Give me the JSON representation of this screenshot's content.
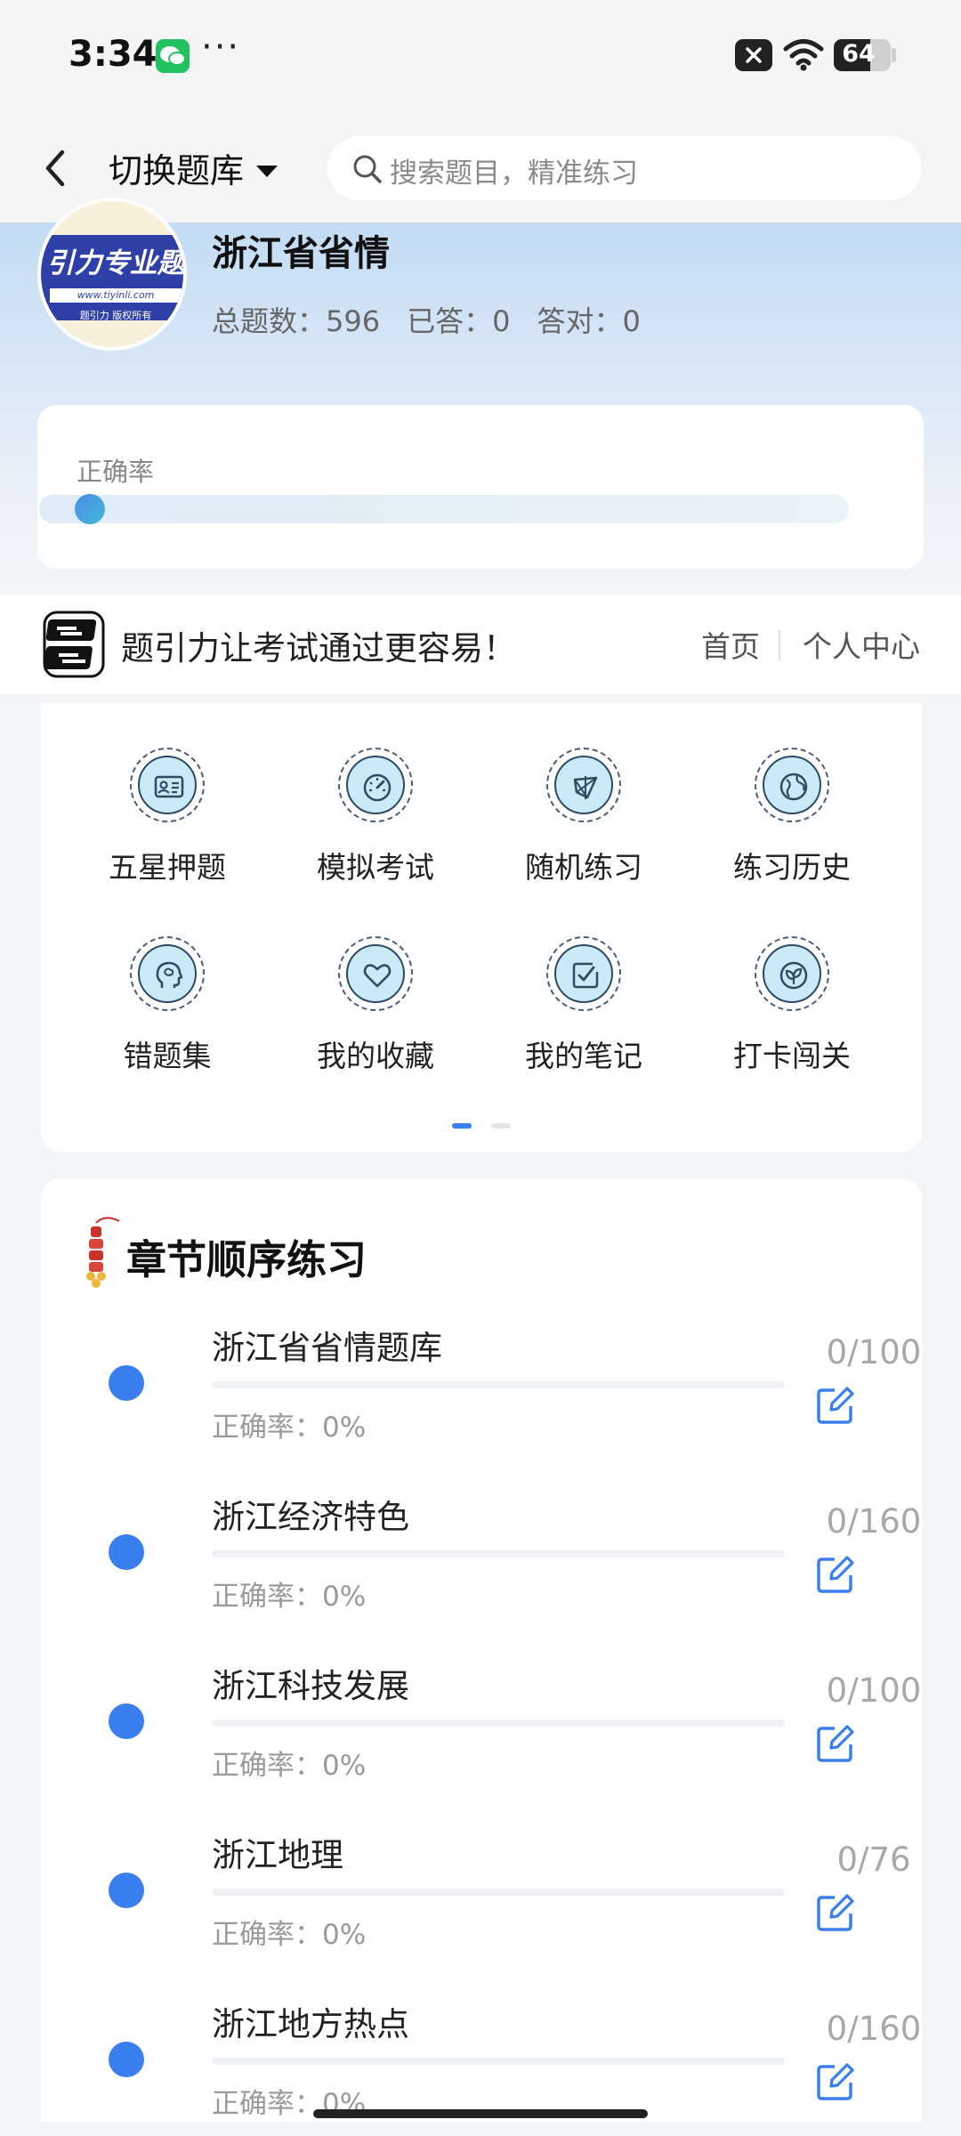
{
  "status_bar": {
    "time": "3:34",
    "more": "···",
    "battery": "64",
    "icons": [
      "wechat-icon",
      "close-notification-icon",
      "wifi-icon",
      "battery-icon"
    ]
  },
  "nav": {
    "back_icon": "chevron-left-icon",
    "switch_label": "切换题库",
    "search_placeholder": "搜索题目，精准练习"
  },
  "header": {
    "logo": {
      "band_text": "引力专业题",
      "url": "www.tiyinli.com",
      "copyright": "题引力 版权所有"
    },
    "title": "浙江省省情",
    "total": "总题数：596",
    "answered": "已答：0",
    "correct": "答对：0"
  },
  "accuracy": {
    "label": "正确率",
    "progress": 0
  },
  "banner": {
    "logo_text": "题引力",
    "slogan": "题引力让考试通过更容易！",
    "home": "首页",
    "personal": "个人中心"
  },
  "features": [
    {
      "label": "五星押题",
      "icon": "id-card-icon"
    },
    {
      "label": "模拟考试",
      "icon": "speedometer-icon"
    },
    {
      "label": "随机练习",
      "icon": "random-shape-icon"
    },
    {
      "label": "练习历史",
      "icon": "globe-history-icon"
    },
    {
      "label": "错题集",
      "icon": "head-brain-icon"
    },
    {
      "label": "我的收藏",
      "icon": "heart-icon"
    },
    {
      "label": "我的笔记",
      "icon": "note-check-icon"
    },
    {
      "label": "打卡闯关",
      "icon": "leaf-badge-icon"
    }
  ],
  "pager": {
    "pages": 2,
    "active": 0
  },
  "chapters": {
    "title": "章节顺序练习",
    "items": [
      {
        "name": "浙江省省情题库",
        "accuracy": "正确率：0%",
        "count": "0/100"
      },
      {
        "name": "浙江经济特色",
        "accuracy": "正确率：0%",
        "count": "0/160"
      },
      {
        "name": "浙江科技发展",
        "accuracy": "正确率：0%",
        "count": "0/100"
      },
      {
        "name": "浙江地理",
        "accuracy": "正确率：0%",
        "count": "0/76"
      },
      {
        "name": "浙江地方热点",
        "accuracy": "正确率：0%",
        "count": "0/160"
      }
    ]
  },
  "colors": {
    "accent": "#3a7ff0",
    "header_gradient_top": "#c3dcf4",
    "logo_band": "#2f3fa8",
    "icon_fill": "#c9eaf6",
    "wechat": "#22c15e"
  }
}
